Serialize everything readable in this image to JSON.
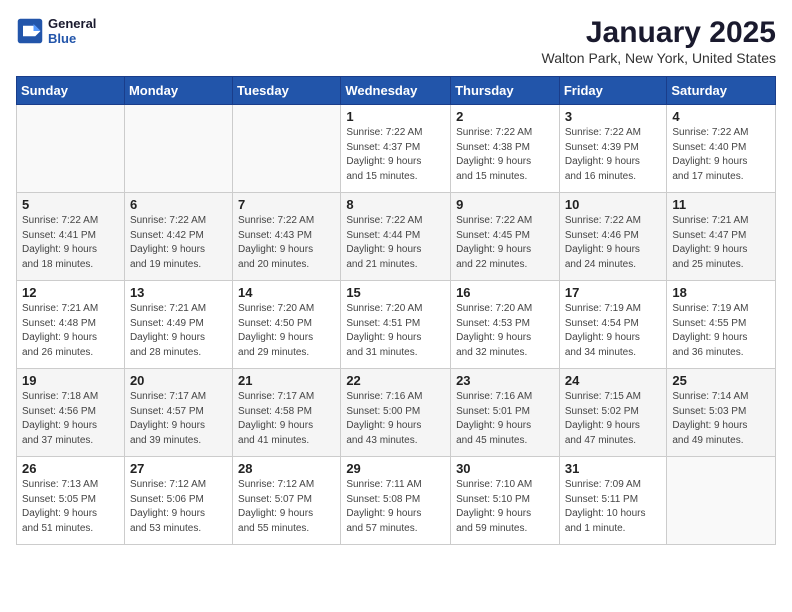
{
  "header": {
    "logo_line1": "General",
    "logo_line2": "Blue",
    "month": "January 2025",
    "location": "Walton Park, New York, United States"
  },
  "days_of_week": [
    "Sunday",
    "Monday",
    "Tuesday",
    "Wednesday",
    "Thursday",
    "Friday",
    "Saturday"
  ],
  "weeks": [
    [
      {
        "day": "",
        "info": ""
      },
      {
        "day": "",
        "info": ""
      },
      {
        "day": "",
        "info": ""
      },
      {
        "day": "1",
        "info": "Sunrise: 7:22 AM\nSunset: 4:37 PM\nDaylight: 9 hours\nand 15 minutes."
      },
      {
        "day": "2",
        "info": "Sunrise: 7:22 AM\nSunset: 4:38 PM\nDaylight: 9 hours\nand 15 minutes."
      },
      {
        "day": "3",
        "info": "Sunrise: 7:22 AM\nSunset: 4:39 PM\nDaylight: 9 hours\nand 16 minutes."
      },
      {
        "day": "4",
        "info": "Sunrise: 7:22 AM\nSunset: 4:40 PM\nDaylight: 9 hours\nand 17 minutes."
      }
    ],
    [
      {
        "day": "5",
        "info": "Sunrise: 7:22 AM\nSunset: 4:41 PM\nDaylight: 9 hours\nand 18 minutes."
      },
      {
        "day": "6",
        "info": "Sunrise: 7:22 AM\nSunset: 4:42 PM\nDaylight: 9 hours\nand 19 minutes."
      },
      {
        "day": "7",
        "info": "Sunrise: 7:22 AM\nSunset: 4:43 PM\nDaylight: 9 hours\nand 20 minutes."
      },
      {
        "day": "8",
        "info": "Sunrise: 7:22 AM\nSunset: 4:44 PM\nDaylight: 9 hours\nand 21 minutes."
      },
      {
        "day": "9",
        "info": "Sunrise: 7:22 AM\nSunset: 4:45 PM\nDaylight: 9 hours\nand 22 minutes."
      },
      {
        "day": "10",
        "info": "Sunrise: 7:22 AM\nSunset: 4:46 PM\nDaylight: 9 hours\nand 24 minutes."
      },
      {
        "day": "11",
        "info": "Sunrise: 7:21 AM\nSunset: 4:47 PM\nDaylight: 9 hours\nand 25 minutes."
      }
    ],
    [
      {
        "day": "12",
        "info": "Sunrise: 7:21 AM\nSunset: 4:48 PM\nDaylight: 9 hours\nand 26 minutes."
      },
      {
        "day": "13",
        "info": "Sunrise: 7:21 AM\nSunset: 4:49 PM\nDaylight: 9 hours\nand 28 minutes."
      },
      {
        "day": "14",
        "info": "Sunrise: 7:20 AM\nSunset: 4:50 PM\nDaylight: 9 hours\nand 29 minutes."
      },
      {
        "day": "15",
        "info": "Sunrise: 7:20 AM\nSunset: 4:51 PM\nDaylight: 9 hours\nand 31 minutes."
      },
      {
        "day": "16",
        "info": "Sunrise: 7:20 AM\nSunset: 4:53 PM\nDaylight: 9 hours\nand 32 minutes."
      },
      {
        "day": "17",
        "info": "Sunrise: 7:19 AM\nSunset: 4:54 PM\nDaylight: 9 hours\nand 34 minutes."
      },
      {
        "day": "18",
        "info": "Sunrise: 7:19 AM\nSunset: 4:55 PM\nDaylight: 9 hours\nand 36 minutes."
      }
    ],
    [
      {
        "day": "19",
        "info": "Sunrise: 7:18 AM\nSunset: 4:56 PM\nDaylight: 9 hours\nand 37 minutes."
      },
      {
        "day": "20",
        "info": "Sunrise: 7:17 AM\nSunset: 4:57 PM\nDaylight: 9 hours\nand 39 minutes."
      },
      {
        "day": "21",
        "info": "Sunrise: 7:17 AM\nSunset: 4:58 PM\nDaylight: 9 hours\nand 41 minutes."
      },
      {
        "day": "22",
        "info": "Sunrise: 7:16 AM\nSunset: 5:00 PM\nDaylight: 9 hours\nand 43 minutes."
      },
      {
        "day": "23",
        "info": "Sunrise: 7:16 AM\nSunset: 5:01 PM\nDaylight: 9 hours\nand 45 minutes."
      },
      {
        "day": "24",
        "info": "Sunrise: 7:15 AM\nSunset: 5:02 PM\nDaylight: 9 hours\nand 47 minutes."
      },
      {
        "day": "25",
        "info": "Sunrise: 7:14 AM\nSunset: 5:03 PM\nDaylight: 9 hours\nand 49 minutes."
      }
    ],
    [
      {
        "day": "26",
        "info": "Sunrise: 7:13 AM\nSunset: 5:05 PM\nDaylight: 9 hours\nand 51 minutes."
      },
      {
        "day": "27",
        "info": "Sunrise: 7:12 AM\nSunset: 5:06 PM\nDaylight: 9 hours\nand 53 minutes."
      },
      {
        "day": "28",
        "info": "Sunrise: 7:12 AM\nSunset: 5:07 PM\nDaylight: 9 hours\nand 55 minutes."
      },
      {
        "day": "29",
        "info": "Sunrise: 7:11 AM\nSunset: 5:08 PM\nDaylight: 9 hours\nand 57 minutes."
      },
      {
        "day": "30",
        "info": "Sunrise: 7:10 AM\nSunset: 5:10 PM\nDaylight: 9 hours\nand 59 minutes."
      },
      {
        "day": "31",
        "info": "Sunrise: 7:09 AM\nSunset: 5:11 PM\nDaylight: 10 hours\nand 1 minute."
      },
      {
        "day": "",
        "info": ""
      }
    ]
  ]
}
